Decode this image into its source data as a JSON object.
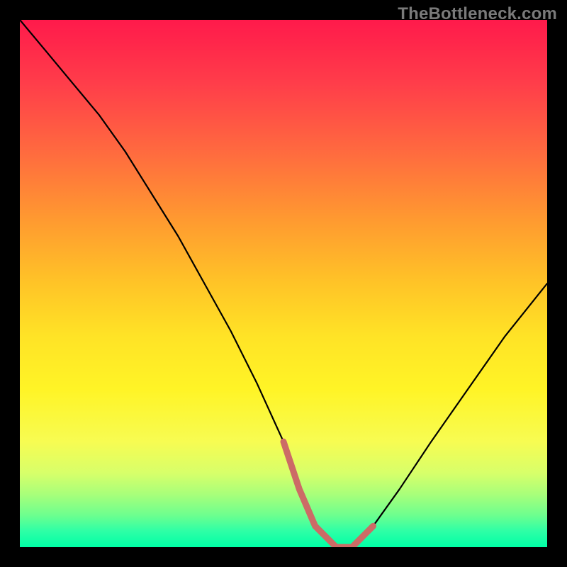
{
  "watermark": {
    "text": "TheBottleneck.com"
  },
  "chart_data": {
    "type": "line",
    "title": "",
    "xlabel": "",
    "ylabel": "",
    "xlim": [
      0,
      100
    ],
    "ylim": [
      0,
      100
    ],
    "grid": false,
    "series": [
      {
        "name": "bottleneck-curve",
        "x": [
          0,
          5,
          10,
          15,
          20,
          25,
          30,
          35,
          40,
          45,
          50,
          53,
          56,
          60,
          63,
          67,
          72,
          78,
          85,
          92,
          100
        ],
        "values": [
          100,
          94,
          88,
          82,
          75,
          67,
          59,
          50,
          41,
          31,
          20,
          11,
          4,
          0,
          0,
          4,
          11,
          20,
          30,
          40,
          50
        ]
      },
      {
        "name": "optimal-range",
        "x": [
          50,
          53,
          56,
          60,
          63,
          67
        ],
        "values": [
          20,
          11,
          4,
          0,
          0,
          4
        ]
      }
    ],
    "colors": {
      "curve": "#000000",
      "optimal_range": "#cc6b66",
      "gradient_top": "#ff1a4b",
      "gradient_bottom": "#00ffa6"
    }
  }
}
